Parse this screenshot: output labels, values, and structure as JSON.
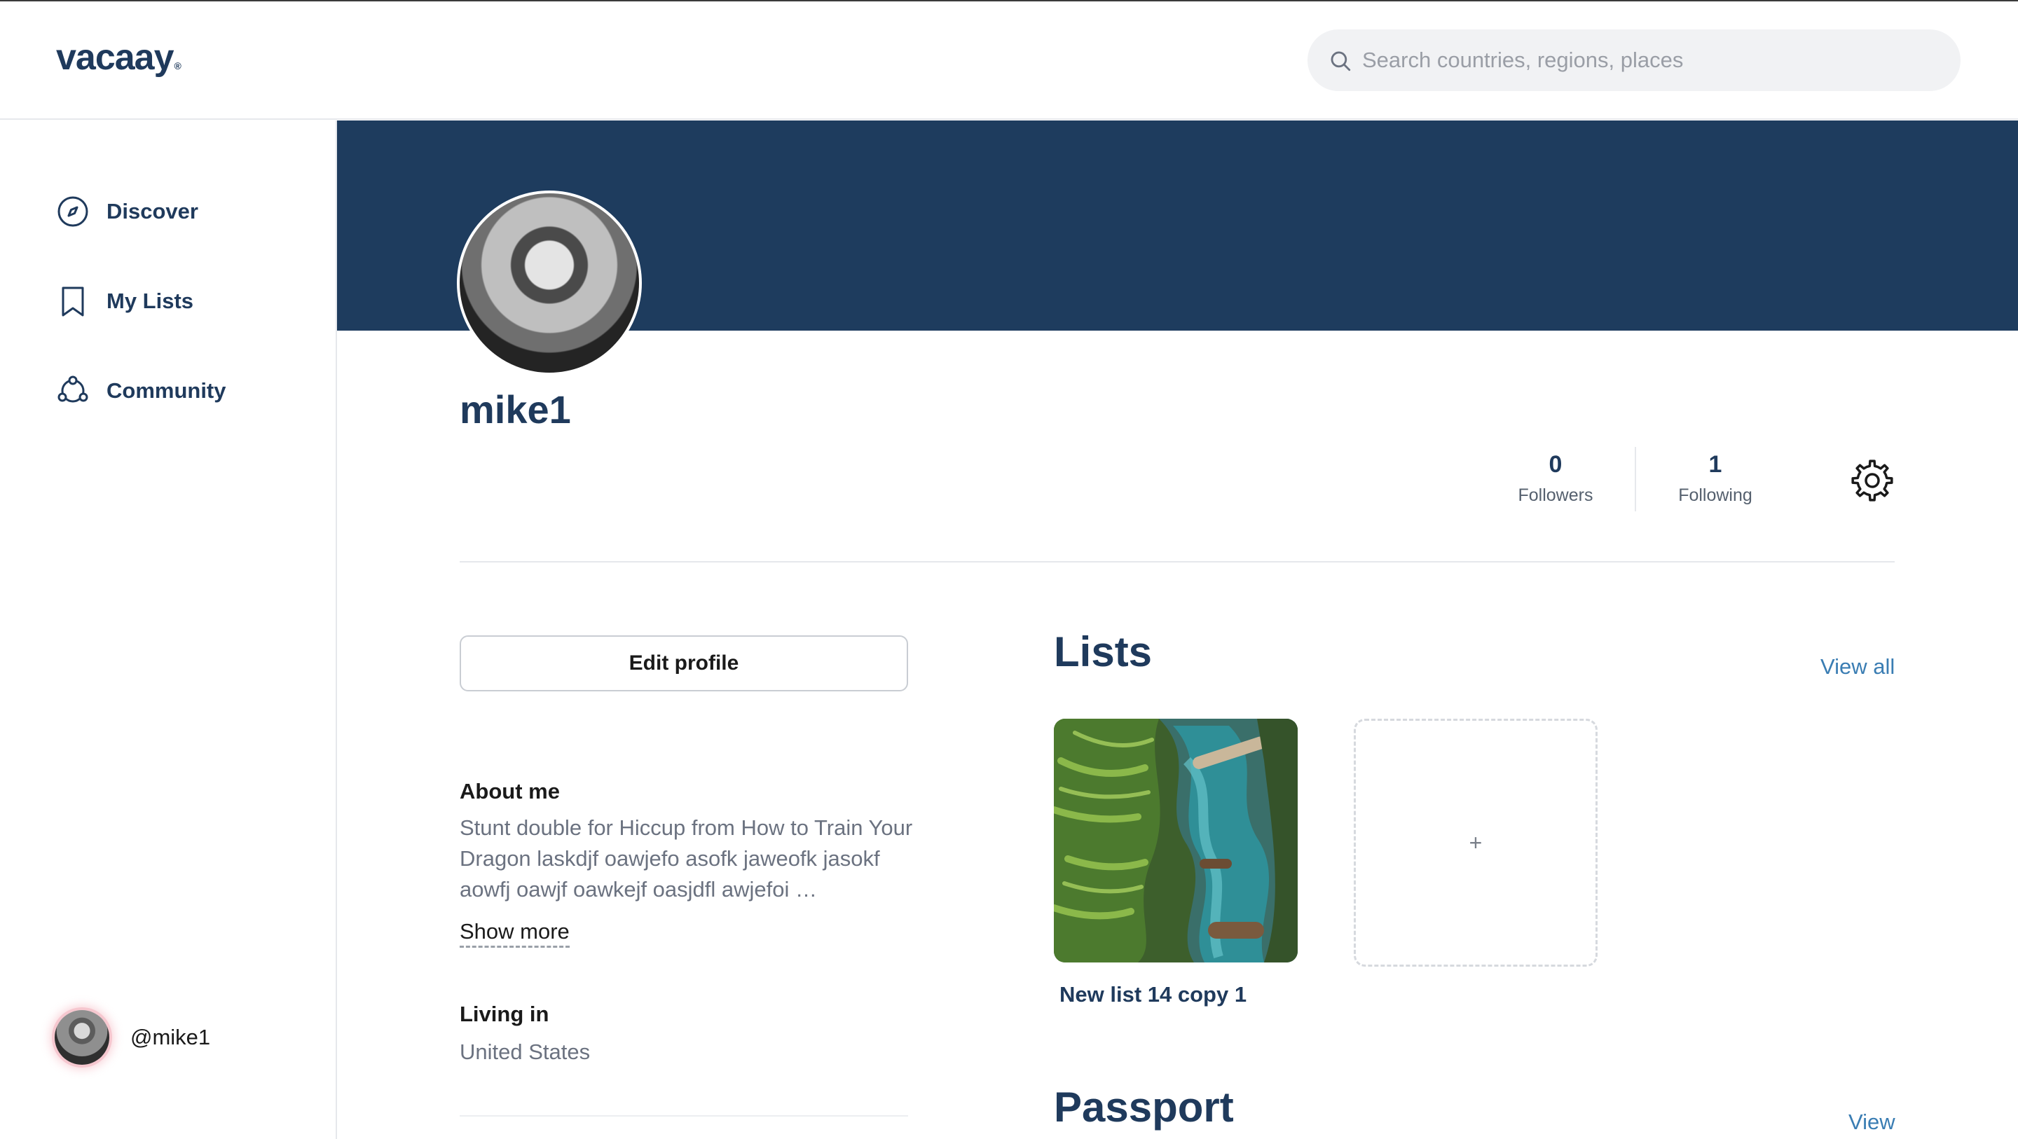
{
  "brand": {
    "name": "vacaay",
    "mark": "®"
  },
  "search": {
    "placeholder": "Search countries, regions, places"
  },
  "sidebar": {
    "items": [
      {
        "label": "Discover",
        "icon": "compass-icon"
      },
      {
        "label": "My Lists",
        "icon": "bookmark-icon"
      },
      {
        "label": "Community",
        "icon": "community-icon"
      }
    ],
    "user": {
      "handle": "@mike1"
    }
  },
  "profile": {
    "username": "mike1",
    "followers": {
      "count": "0",
      "label": "Followers"
    },
    "following": {
      "count": "1",
      "label": "Following"
    },
    "edit_label": "Edit profile",
    "about_title": "About me",
    "about_text": "Stunt double for Hiccup from How to Train Your Dragon laskdjf oawjefo asofk jaweofk jasokf aowfj oawjf oawkejf oasjdfl awjefoi …",
    "show_more": "Show more",
    "living_title": "Living in",
    "living_value": "United States"
  },
  "lists": {
    "title": "Lists",
    "view_all": "View all",
    "items": [
      {
        "name": "New list 14 copy 1"
      }
    ],
    "add_label": "+"
  },
  "passport": {
    "title": "Passport",
    "view": "View"
  },
  "colors": {
    "brand": "#1f3a5c",
    "banner": "#1e3c5e",
    "link": "#3a7db3"
  }
}
